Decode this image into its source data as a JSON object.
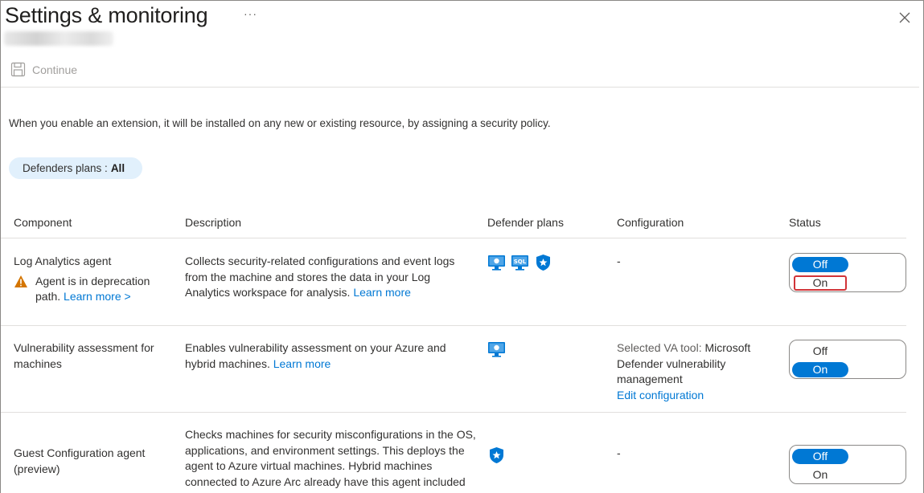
{
  "header": {
    "title": "Settings & monitoring",
    "more": "···"
  },
  "toolbar": {
    "continue_label": "Continue"
  },
  "intro_text": "When you enable an extension, it will be installed on any new or existing resource, by assigning a security policy.",
  "filter": {
    "label": "Defenders plans : ",
    "value": "All"
  },
  "table": {
    "columns": [
      "Component",
      "Description",
      "Defender plans",
      "Configuration",
      "Status"
    ],
    "rows": [
      {
        "component": "Log Analytics agent",
        "warning": "Agent is in deprecation path.",
        "warning_link": "Learn more >",
        "description": "Collects security-related configurations and event logs from the machine and stores the data in your Log Analytics workspace for analysis.",
        "description_link": "Learn more",
        "plans": [
          "server-icon",
          "sql-server-icon",
          "defender-shield-icon"
        ],
        "configuration": "-",
        "status_options": [
          "Off",
          "On"
        ],
        "status_selected": "Off"
      },
      {
        "component": "Vulnerability assessment for machines",
        "description": "Enables vulnerability assessment on your Azure and hybrid machines.",
        "description_link": "Learn more",
        "plans": [
          "server-icon"
        ],
        "configuration_label": "Selected VA tool:",
        "configuration_value": "Microsoft Defender vulnerability management",
        "configuration_link": "Edit configuration",
        "status_options": [
          "Off",
          "On"
        ],
        "status_selected": "On"
      },
      {
        "component": "Guest Configuration agent (preview)",
        "description": "Checks machines for security misconfigurations in the OS, applications, and environment settings. This deploys the agent to Azure virtual machines. Hybrid machines connected to Azure Arc already have this agent included in the Azure Connected Machine agent.",
        "plans": [
          "defender-shield-icon"
        ],
        "configuration": "-",
        "status_options": [
          "Off",
          "On"
        ],
        "status_selected": "Off"
      }
    ]
  },
  "colors": {
    "accent": "#0078d4",
    "pill_background": "#e1f0fc",
    "warning": "#d47500",
    "highlight_border": "#d13438"
  }
}
